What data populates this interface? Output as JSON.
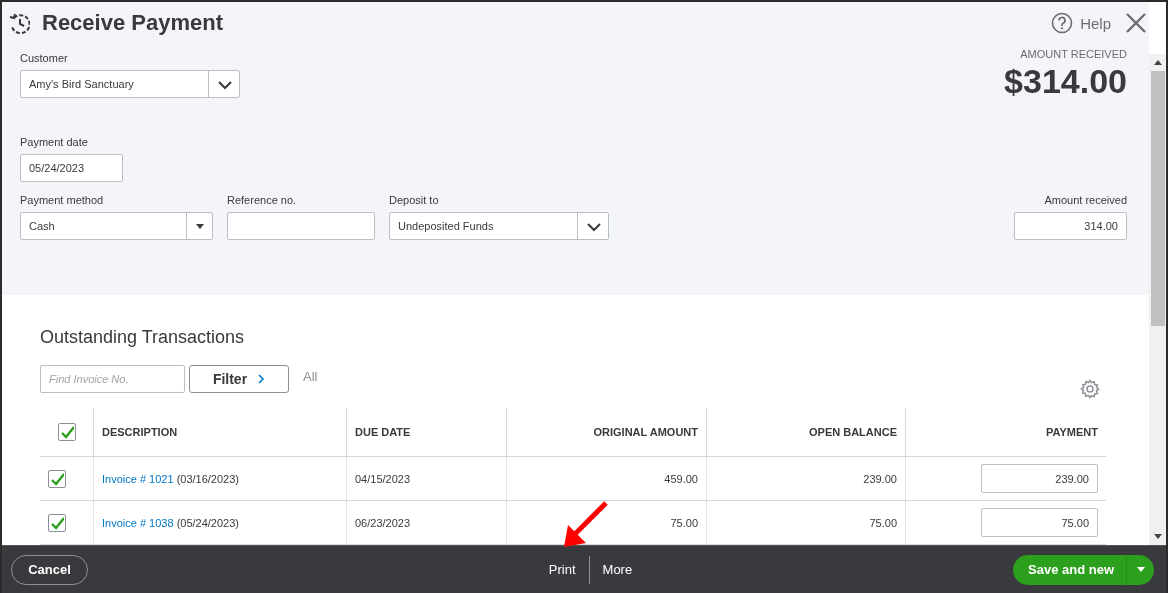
{
  "window": {
    "title": "Receive Payment"
  },
  "help": "Help",
  "customer": {
    "label": "Customer",
    "value": "Amy's Bird Sanctuary"
  },
  "amount_summary": {
    "label": "AMOUNT RECEIVED",
    "value": "$314.00"
  },
  "payment_date": {
    "label": "Payment date",
    "value": "05/24/2023"
  },
  "payment_method": {
    "label": "Payment method",
    "value": "Cash"
  },
  "reference_no": {
    "label": "Reference no."
  },
  "deposit_to": {
    "label": "Deposit to",
    "value": "Undeposited Funds"
  },
  "amount_received": {
    "label": "Amount received",
    "value": "314.00"
  },
  "outstanding": {
    "title": "Outstanding Transactions",
    "search": {
      "placeholder": "Find Invoice No."
    },
    "filter": "Filter",
    "filter_value": "All",
    "table": {
      "select_all": {
        "checked": true
      },
      "columns": [
        "DESCRIPTION",
        "DUE DATE",
        "ORIGINAL AMOUNT",
        "OPEN BALANCE",
        "PAYMENT"
      ],
      "rows": [
        {
          "checked": true,
          "invoice": "Invoice # 1021",
          "invoice_date": "(03/16/2023)",
          "due_date": "04/15/2023",
          "original_amount": "459.00",
          "open_balance": "239.00",
          "payment": "239.00"
        },
        {
          "checked": true,
          "invoice": "Invoice # 1038",
          "invoice_date": "(05/24/2023)",
          "due_date": "06/23/2023",
          "original_amount": "75.00",
          "open_balance": "75.00",
          "payment": "75.00"
        }
      ]
    }
  },
  "footer": {
    "cancel": "Cancel",
    "print": "Print",
    "more": "More",
    "save": "Save and new"
  }
}
